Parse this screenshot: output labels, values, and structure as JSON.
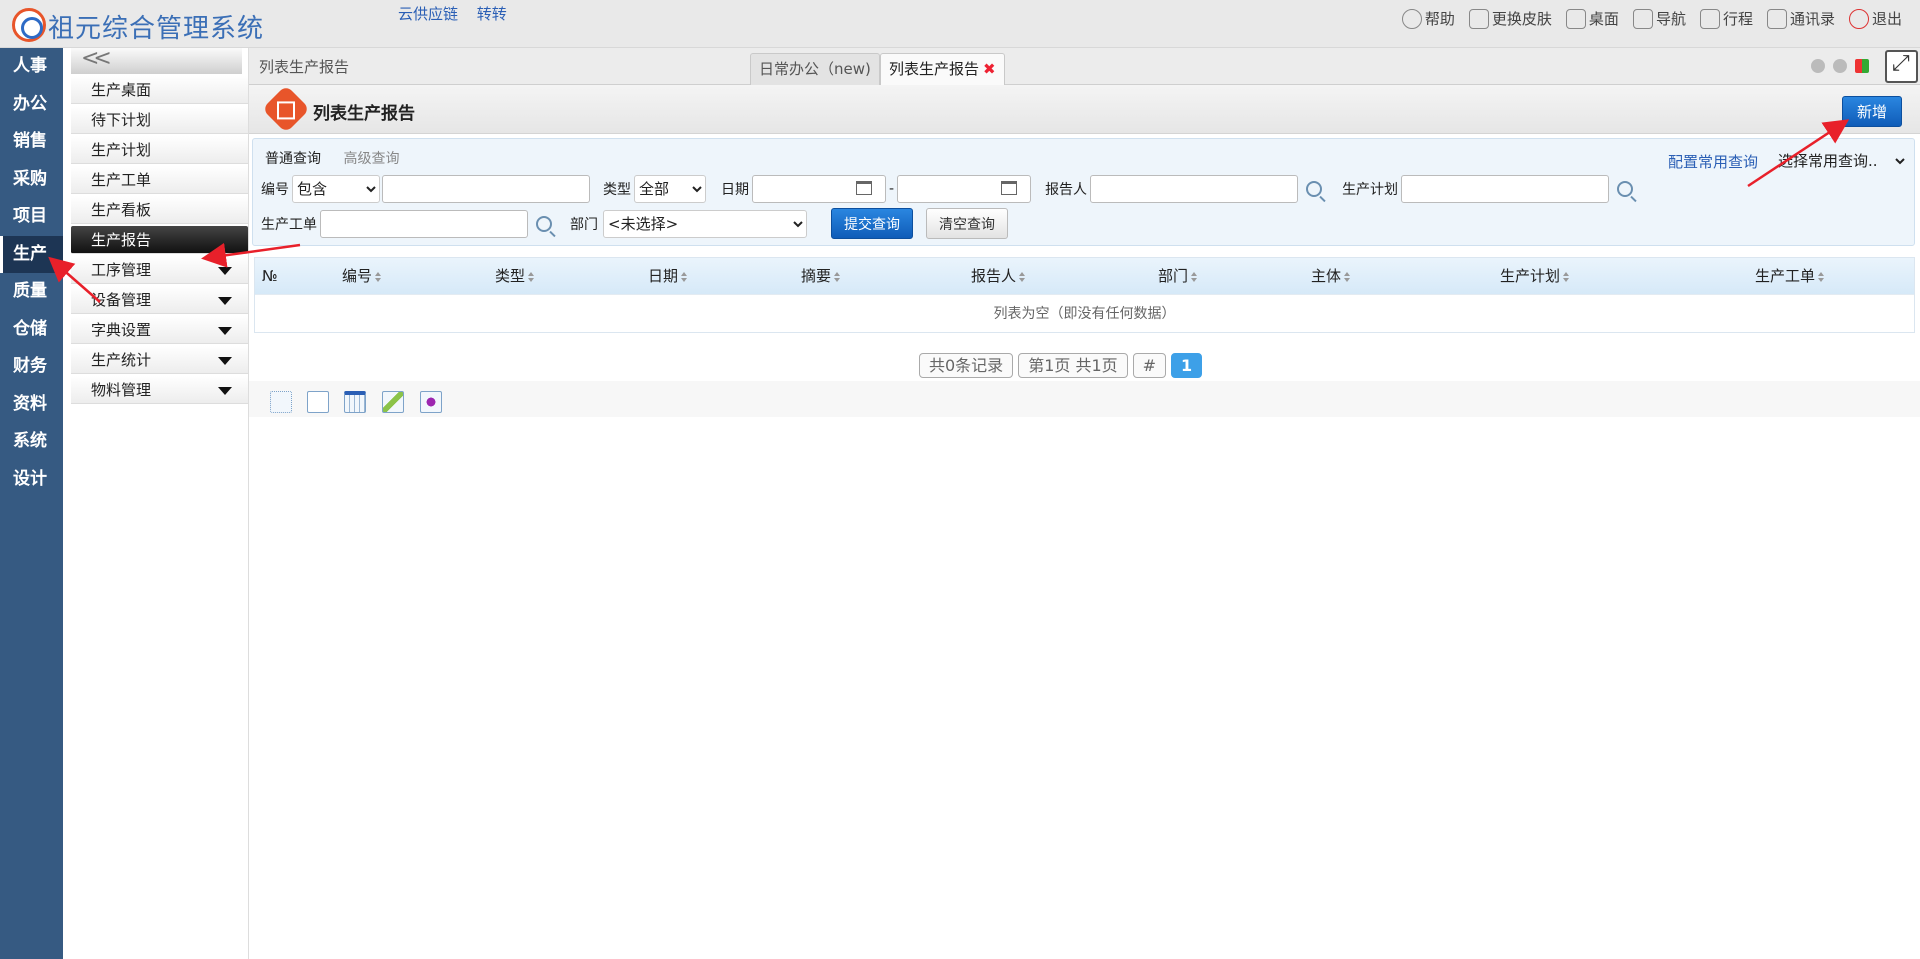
{
  "app": {
    "title": "祖元综合管理系统"
  },
  "top_links": [
    "云供应链",
    "转转"
  ],
  "top_nav": [
    {
      "label": "帮助",
      "icon": "help-icon"
    },
    {
      "label": "更换皮肤",
      "icon": "shirt-icon"
    },
    {
      "label": "桌面",
      "icon": "home-icon"
    },
    {
      "label": "导航",
      "icon": "grid-icon"
    },
    {
      "label": "行程",
      "icon": "calendar-icon"
    },
    {
      "label": "通讯录",
      "icon": "contacts-icon"
    },
    {
      "label": "退出",
      "icon": "power-icon"
    }
  ],
  "left_nav": [
    "人事",
    "办公",
    "销售",
    "采购",
    "项目",
    "生产",
    "质量",
    "仓储",
    "财务",
    "资料",
    "系统",
    "设计"
  ],
  "left_nav_active": "生产",
  "sub_nav": {
    "collapse_label": "<<",
    "items": [
      {
        "label": "生产桌面",
        "expandable": false
      },
      {
        "label": "待下计划",
        "expandable": false
      },
      {
        "label": "生产计划",
        "expandable": false
      },
      {
        "label": "生产工单",
        "expandable": false
      },
      {
        "label": "生产看板",
        "expandable": false
      },
      {
        "label": "生产报告",
        "expandable": false,
        "active": true
      },
      {
        "label": "工序管理",
        "expandable": true
      },
      {
        "label": "设备管理",
        "expandable": true
      },
      {
        "label": "字典设置",
        "expandable": true
      },
      {
        "label": "生产统计",
        "expandable": true
      },
      {
        "label": "物料管理",
        "expandable": true
      }
    ]
  },
  "tabbar": {
    "breadcrumb": "列表生产报告",
    "tabs": [
      {
        "label": "日常办公（new)",
        "active": false
      },
      {
        "label": "列表生产报告",
        "active": true,
        "closable": true
      }
    ],
    "close_glyph": "✖"
  },
  "page_header": {
    "title": "列表生产报告",
    "new_button": "新增"
  },
  "query": {
    "tabs": [
      "普通查询",
      "高级查询"
    ],
    "config_link": "配置常用查询",
    "saved_query_select": "选择常用查询..",
    "fields": {
      "code_label": "编号",
      "code_op": "包含",
      "code_value": "",
      "type_label": "类型",
      "type_value": "全部",
      "date_label": "日期",
      "date_from": "",
      "date_sep": "-",
      "date_to": "",
      "reporter_label": "报告人",
      "reporter_value": "",
      "plan_label": "生产计划",
      "plan_value": "",
      "order_label": "生产工单",
      "order_value": "",
      "dept_label": "部门",
      "dept_value": "<未选择>"
    },
    "submit": "提交查询",
    "clear": "清空查询"
  },
  "grid": {
    "columns": [
      "№",
      "编号",
      "类型",
      "日期",
      "摘要",
      "报告人",
      "部门",
      "主体",
      "生产计划",
      "生产工单"
    ],
    "empty_text": "列表为空（即没有任何数据）"
  },
  "pager": {
    "total": "共0条记录",
    "pages": "第1页 共1页",
    "hash": "#",
    "current": "1"
  },
  "toolbar_icons": [
    "grid-dotted-icon",
    "document-icon",
    "table-icon",
    "edit-icon",
    "puzzle-icon"
  ],
  "colors": {
    "nav_bg": "#365a82",
    "accent": "#1565c0",
    "annotation": "#e8202a"
  }
}
